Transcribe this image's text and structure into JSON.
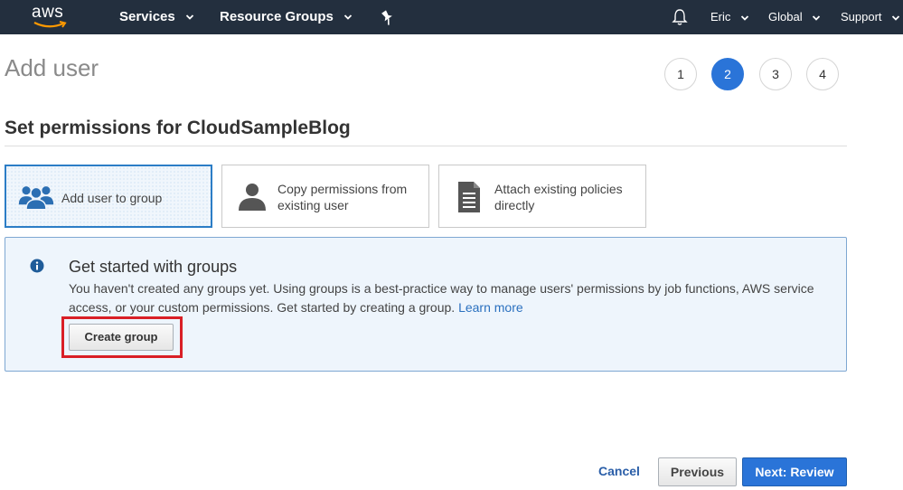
{
  "nav": {
    "logo": "aws",
    "services": "Services",
    "resource_groups": "Resource Groups",
    "user": "Eric",
    "region": "Global",
    "support": "Support",
    "icons": {
      "pin": "pin-icon",
      "bell": "bell-icon"
    }
  },
  "page": {
    "title": "Add user",
    "steps": [
      "1",
      "2",
      "3",
      "4"
    ],
    "active_step": "2",
    "section_title": "Set permissions for CloudSampleBlog"
  },
  "options": [
    {
      "label": "Add user to group",
      "icon": "users-icon",
      "selected": true
    },
    {
      "label_line1": "Copy permissions from",
      "label_line2": "existing user",
      "icon": "user-icon",
      "selected": false
    },
    {
      "label_line1": "Attach existing policies",
      "label_line2": "directly",
      "icon": "document-icon",
      "selected": false
    }
  ],
  "info": {
    "title": "Get started with groups",
    "body_line1": "You haven't created any groups yet. Using groups is a best-practice way to manage users' permissions by job functions, AWS service",
    "body_line2": "access, or your custom permissions. Get started by creating a group.",
    "link": "Learn more",
    "button": "Create group"
  },
  "footer": {
    "cancel": "Cancel",
    "previous": "Previous",
    "next": "Next: Review"
  },
  "colors": {
    "nav_bg": "#232f3e",
    "primary": "#2a74d8",
    "highlight": "#d91f26",
    "info_bg": "#eef5fc"
  }
}
